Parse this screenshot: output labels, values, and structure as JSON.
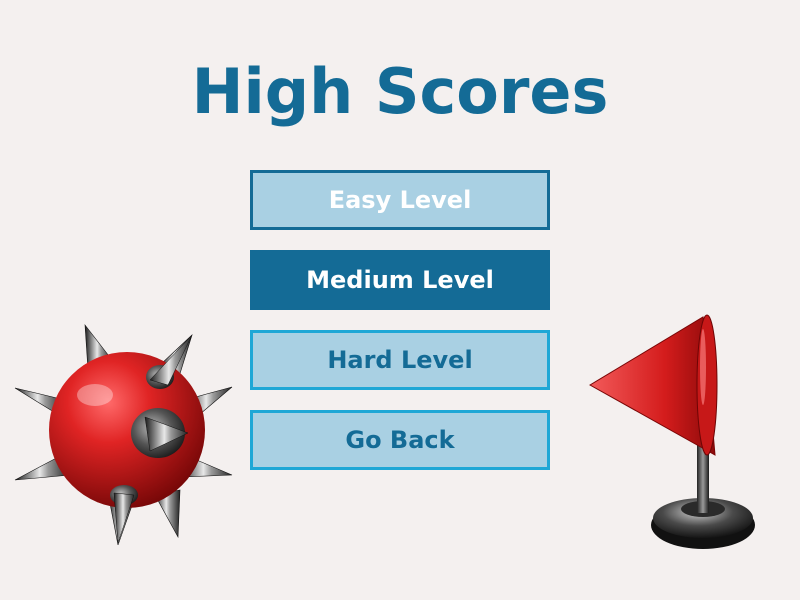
{
  "screen": {
    "title": "High Scores"
  },
  "menu": {
    "easy_label": "Easy Level",
    "medium_label": "Medium Level",
    "hard_label": "Hard Level",
    "back_label": "Go Back",
    "selected": "Medium Level"
  },
  "decorations": {
    "left_icon": "mine-icon",
    "right_icon": "flag-icon"
  },
  "colors": {
    "background": "#f4f0ef",
    "title": "#146b96",
    "button_light": "#a9d0e3",
    "button_dark": "#146b96",
    "button_border_bright": "#1fa7d6",
    "mine_red": "#d62020",
    "flag_red": "#cc1b1b"
  }
}
